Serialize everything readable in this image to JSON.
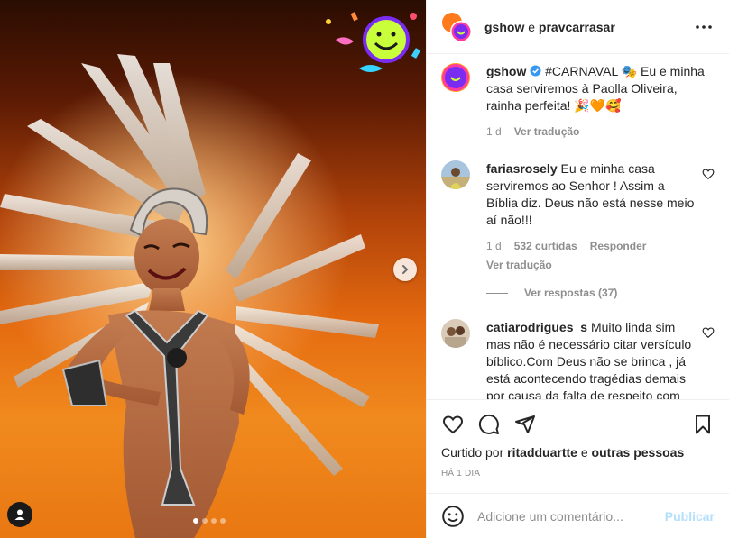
{
  "header": {
    "user": "gshow",
    "connector": " e ",
    "collaborator": "pravcarrasar"
  },
  "caption": {
    "user": "gshow",
    "text": " #CARNAVAL 🎭 Eu e minha casa serviremos à Paolla Oliveira, rainha perfeita! 🎉🧡🥰",
    "time": "1 d",
    "translate": "Ver tradução"
  },
  "comments": [
    {
      "user": "fariasrosely",
      "text": " Eu e minha casa serviremos ao Senhor ! Assim a Bíblia diz. Deus não está nesse meio aí não!!!",
      "time": "1 d",
      "likes": "532 curtidas",
      "reply": "Responder",
      "translate": "Ver tradução",
      "view_replies": "Ver respostas (37)"
    },
    {
      "user": "catiarodrigues_s",
      "text": " Muito linda sim mas não é necessário citar versículo bíblico.Com Deus não se brinca , já está acontecendo tragédias demais por causa da falta de respeito com"
    }
  ],
  "liked_by": {
    "prefix": "Curtido por ",
    "user": "ritadduartte",
    "connector": " e ",
    "others": "outras pessoas"
  },
  "post_time": "HÁ 1 DIA",
  "composer": {
    "placeholder": "Adicione um comentário...",
    "publish": "Publicar"
  },
  "carousel": {
    "count": 4,
    "active": 1
  },
  "icons": {
    "more": "more-horizontal-icon",
    "verified": "verified-badge-icon",
    "like": "heart-icon",
    "comment": "comment-icon",
    "share": "send-icon",
    "save": "bookmark-icon",
    "emoji": "emoji-icon",
    "next": "chevron-right-icon",
    "tag": "user-tag-icon"
  },
  "colors": {
    "accent": "#0095f6",
    "publish_disabled": "#b2dffc",
    "verified": "#3897f0",
    "muted": "#8e8e8e"
  }
}
